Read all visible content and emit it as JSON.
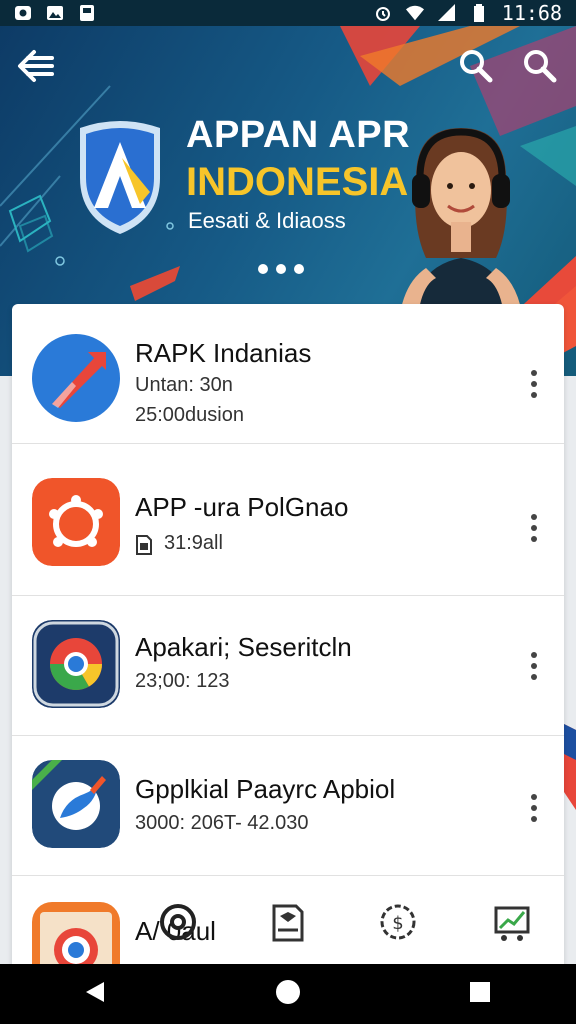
{
  "status_bar": {
    "time": "11:68",
    "left_icons": [
      "notification-icon",
      "image-icon",
      "card-icon"
    ],
    "right_icons": [
      "alarm-icon",
      "wifi-icon",
      "signal-icon",
      "battery-icon"
    ]
  },
  "hero": {
    "title": "APPAN APR",
    "subtitle": "INDONESIA",
    "tagline": "Eesati & Idiaoss",
    "colors": {
      "title": "#ffffff",
      "subtitle": "#f7c52a"
    },
    "carousel_pages": 3
  },
  "apps": [
    {
      "name": "RAPK Indanias",
      "line1": "Untan: 30n",
      "line2": "25:00dusion",
      "icon": "apk-arrow-icon",
      "icon_color": "#2a7ad8"
    },
    {
      "name": "APP -ura PolGnao",
      "line1": "31:9all",
      "line1_icon": "file-icon",
      "line2": "",
      "icon": "gear-app-icon",
      "icon_color": "#f0552a"
    },
    {
      "name": "Apakari; Seseritcln",
      "line1": "23;00: 123",
      "line2": "",
      "icon": "chrome-icon",
      "icon_color": "#1d3b6a"
    },
    {
      "name": "Gpplkial Paayrc Apbiol",
      "line1": "3000: 206T- 42.030",
      "line2": "",
      "icon": "paint-brush-icon",
      "icon_color": "#214a7a"
    },
    {
      "name": "A/ 0aul",
      "line1": "",
      "line2": "",
      "icon": "camera-app-icon",
      "icon_color": "#e05a2a"
    }
  ],
  "bottom_tabs": [
    "camera-icon",
    "document-icon",
    "settings-dollar-icon",
    "chart-icon"
  ],
  "nav": [
    "back-icon",
    "home-icon",
    "recents-icon"
  ]
}
